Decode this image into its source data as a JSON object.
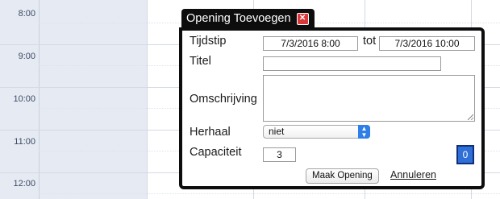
{
  "calendar": {
    "times": [
      "8:00",
      "9:00",
      "10:00",
      "11:00",
      "12:00"
    ]
  },
  "dialog": {
    "title": "Opening Toevoegen",
    "close_icon": "close-icon",
    "fields": {
      "tijdstip_label": "Tijdstip",
      "start_value": "7/3/2016  8:00",
      "tot_label": "tot",
      "end_value": "7/3/2016  10:00",
      "titel_label": "Titel",
      "titel_value": "",
      "omschrijving_label": "Omschrijving",
      "omschrijving_value": "",
      "herhaal_label": "Herhaal",
      "herhaal_value": "niet",
      "capaciteit_label": "Capaciteit",
      "capaciteit_value": "3",
      "count_badge": "0"
    },
    "buttons": {
      "submit_label": "Maak Opening",
      "cancel_label": "Annuleren"
    }
  },
  "colors": {
    "gutter": "#e6ebf3",
    "dialog_frame": "#0d0d0d",
    "close_red": "#d9383a",
    "badge_blue": "#2f6fd8"
  }
}
